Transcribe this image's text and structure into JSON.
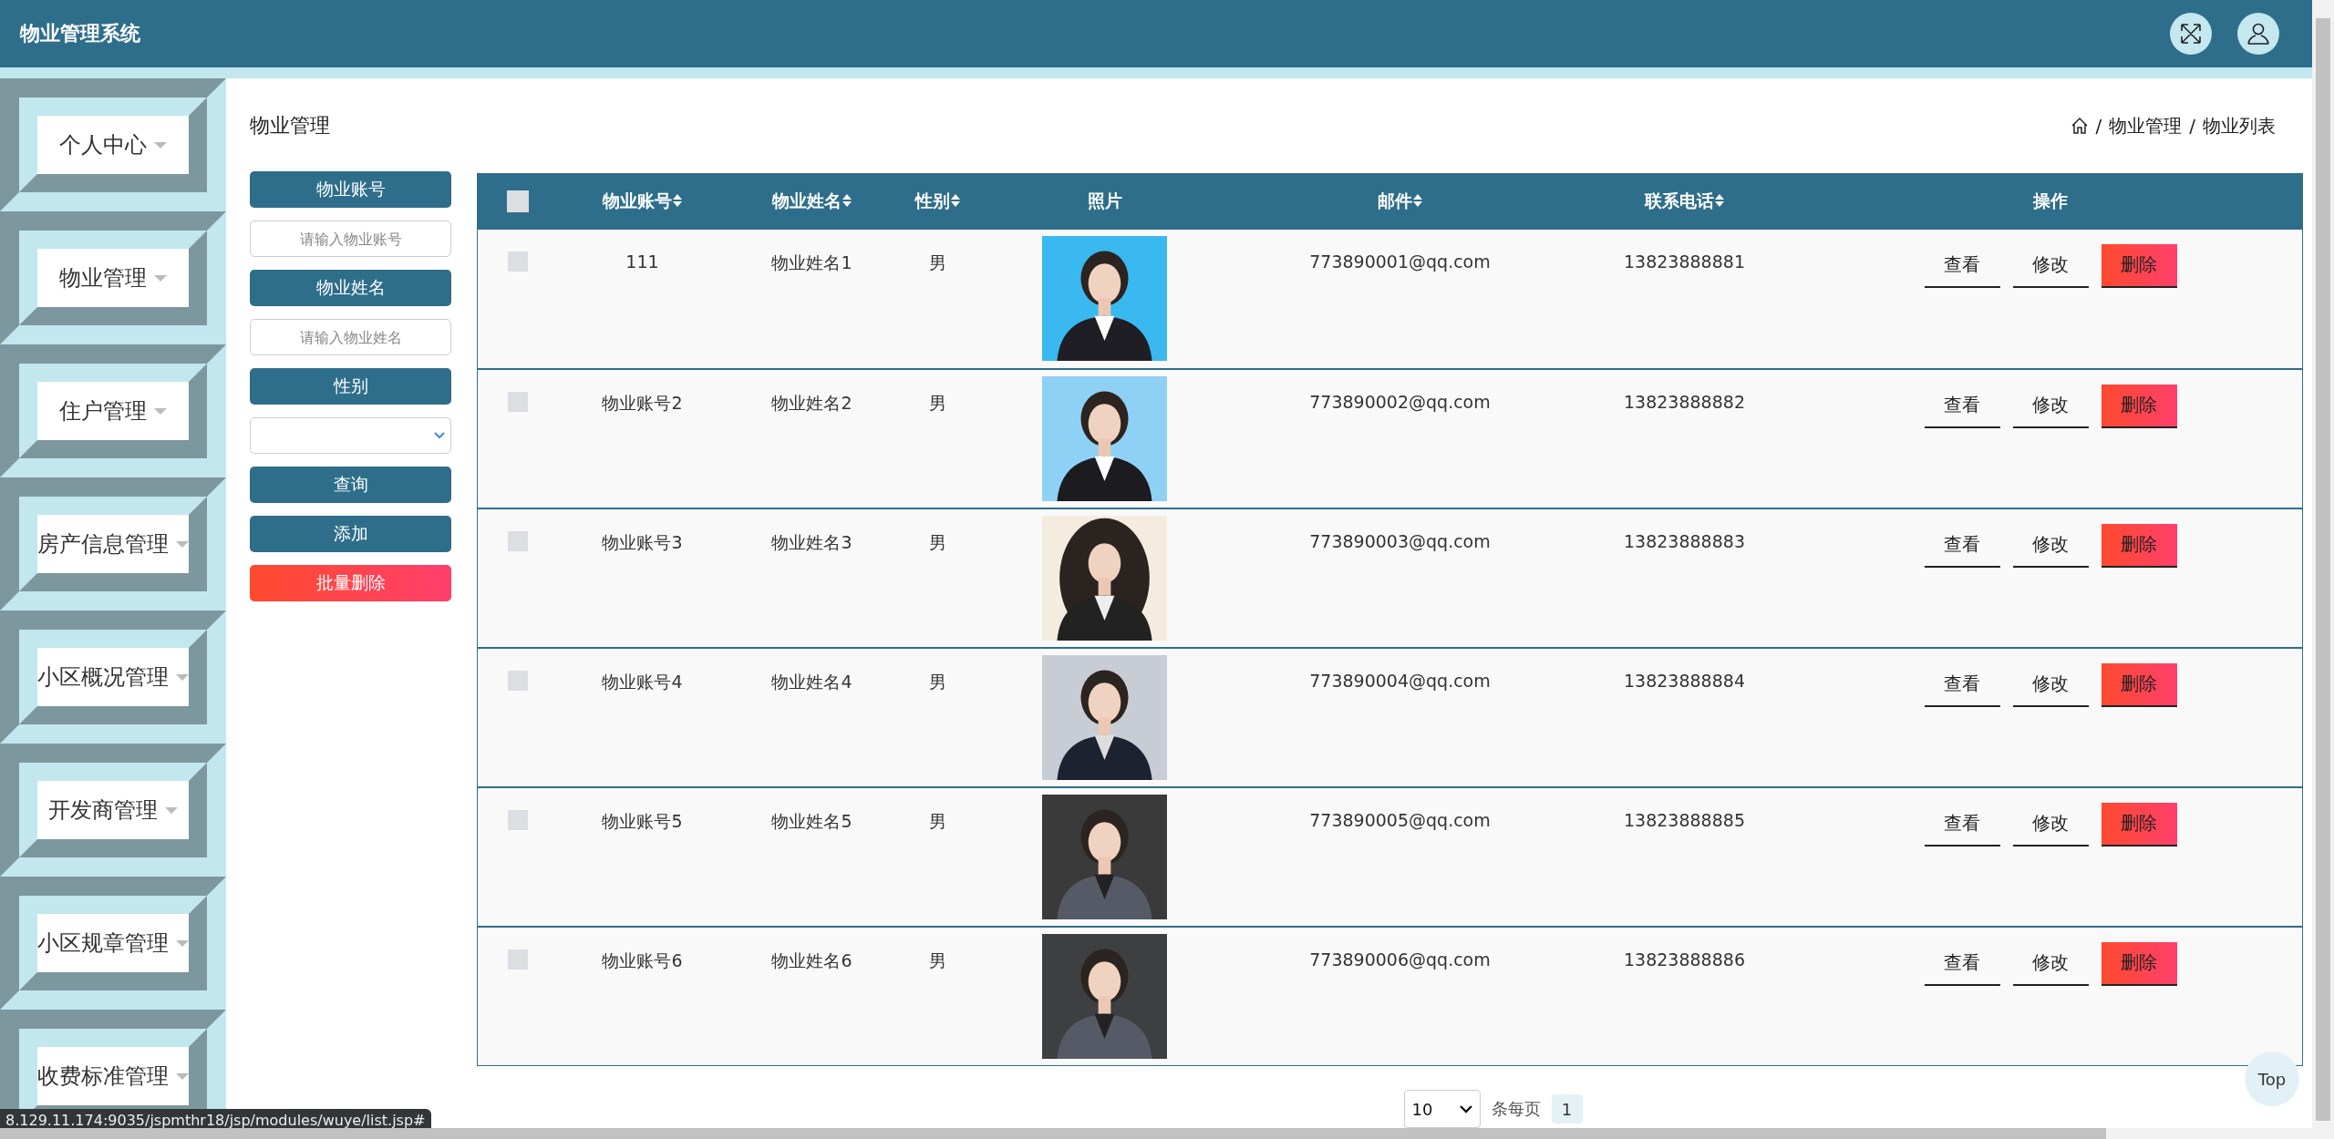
{
  "header": {
    "title": "物业管理系统"
  },
  "sidebar": {
    "items": [
      {
        "label": "个人中心"
      },
      {
        "label": "物业管理"
      },
      {
        "label": "住户管理"
      },
      {
        "label": "房产信息管理"
      },
      {
        "label": "小区概况管理"
      },
      {
        "label": "开发商管理"
      },
      {
        "label": "小区规章管理"
      },
      {
        "label": "收费标准管理"
      }
    ]
  },
  "page_title": "物业管理",
  "breadcrumb": {
    "separator": "/",
    "items": [
      "物业管理",
      "物业列表"
    ]
  },
  "filters": [
    {
      "kind": "label",
      "text": "物业账号"
    },
    {
      "kind": "input",
      "placeholder": "请输入物业账号"
    },
    {
      "kind": "label",
      "text": "物业姓名"
    },
    {
      "kind": "input",
      "placeholder": "请输入物业姓名"
    },
    {
      "kind": "label",
      "text": "性别"
    },
    {
      "kind": "select"
    },
    {
      "kind": "button",
      "text": "查询"
    },
    {
      "kind": "button",
      "text": "添加"
    },
    {
      "kind": "danger",
      "text": "批量删除"
    }
  ],
  "table": {
    "select_all": {
      "checked": false
    },
    "columns": [
      {
        "label": "物业账号",
        "sortable": true
      },
      {
        "label": "物业姓名",
        "sortable": true
      },
      {
        "label": "性别",
        "sortable": true
      },
      {
        "label": "照片",
        "sortable": false
      },
      {
        "label": "邮件",
        "sortable": true
      },
      {
        "label": "联系电话",
        "sortable": true
      },
      {
        "label": "操作",
        "sortable": false
      }
    ],
    "rows": [
      {
        "checked": false,
        "account": "111",
        "name": "物业姓名1",
        "gender": "男",
        "email": "773890001@qq.com",
        "phone": "13823888881",
        "actions": [
          {
            "label": "查看",
            "kind": "plain"
          },
          {
            "label": "修改",
            "kind": "plain"
          },
          {
            "label": "删除",
            "kind": "danger"
          }
        ]
      },
      {
        "checked": false,
        "account": "物业账号2",
        "name": "物业姓名2",
        "gender": "男",
        "email": "773890002@qq.com",
        "phone": "13823888882",
        "actions": [
          {
            "label": "查看",
            "kind": "plain"
          },
          {
            "label": "修改",
            "kind": "plain"
          },
          {
            "label": "删除",
            "kind": "danger"
          }
        ]
      },
      {
        "checked": false,
        "account": "物业账号3",
        "name": "物业姓名3",
        "gender": "男",
        "email": "773890003@qq.com",
        "phone": "13823888883",
        "actions": [
          {
            "label": "查看",
            "kind": "plain"
          },
          {
            "label": "修改",
            "kind": "plain"
          },
          {
            "label": "删除",
            "kind": "danger"
          }
        ]
      },
      {
        "checked": false,
        "account": "物业账号4",
        "name": "物业姓名4",
        "gender": "男",
        "email": "773890004@qq.com",
        "phone": "13823888884",
        "actions": [
          {
            "label": "查看",
            "kind": "plain"
          },
          {
            "label": "修改",
            "kind": "plain"
          },
          {
            "label": "删除",
            "kind": "danger"
          }
        ]
      },
      {
        "checked": false,
        "account": "物业账号5",
        "name": "物业姓名5",
        "gender": "男",
        "email": "773890005@qq.com",
        "phone": "13823888885",
        "actions": [
          {
            "label": "查看",
            "kind": "plain"
          },
          {
            "label": "修改",
            "kind": "plain"
          },
          {
            "label": "删除",
            "kind": "danger"
          }
        ]
      },
      {
        "checked": false,
        "account": "物业账号6",
        "name": "物业姓名6",
        "gender": "男",
        "email": "773890006@qq.com",
        "phone": "13823888886",
        "actions": [
          {
            "label": "查看",
            "kind": "plain"
          },
          {
            "label": "修改",
            "kind": "plain"
          },
          {
            "label": "删除",
            "kind": "danger"
          }
        ]
      }
    ]
  },
  "pagination": {
    "page_size": "10",
    "per_page_label": "条每页",
    "pages": [
      {
        "label": "1",
        "selected": true
      }
    ]
  },
  "top_button": "Top",
  "status_url": "8.129.11.174:9035/jspmthr18/jsp/modules/wuye/list.jsp#"
}
